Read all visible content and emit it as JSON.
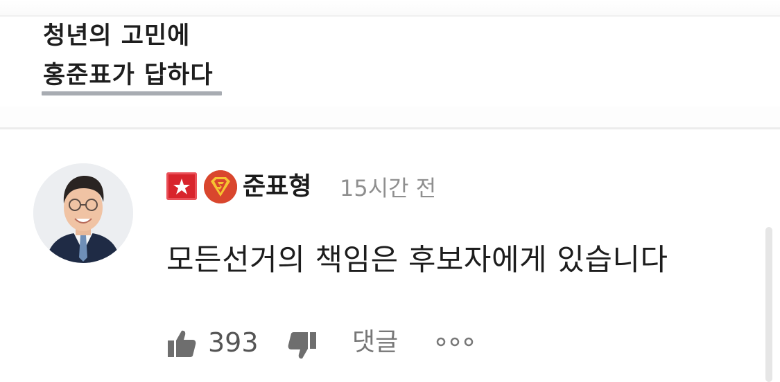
{
  "post": {
    "title_line1": "청년의 고민에",
    "title_line2": "홍준표가 답하다"
  },
  "comment": {
    "author": "준표형",
    "time": "15시간 전",
    "text": "모든선거의 책임은 후보자에게 있습니다",
    "likes": "393",
    "reply_label": "댓글"
  },
  "icons": {
    "badge1": "red-star-badge",
    "badge2": "superman-badge",
    "like": "thumbs-up-icon",
    "dislike": "thumbs-down-icon",
    "more": "more-dots-icon"
  },
  "colors": {
    "badge_red": "#d8242c",
    "badge_orange": "#d9462d",
    "underline": "#a8acb2",
    "icon_gray": "#6e6e6e"
  }
}
